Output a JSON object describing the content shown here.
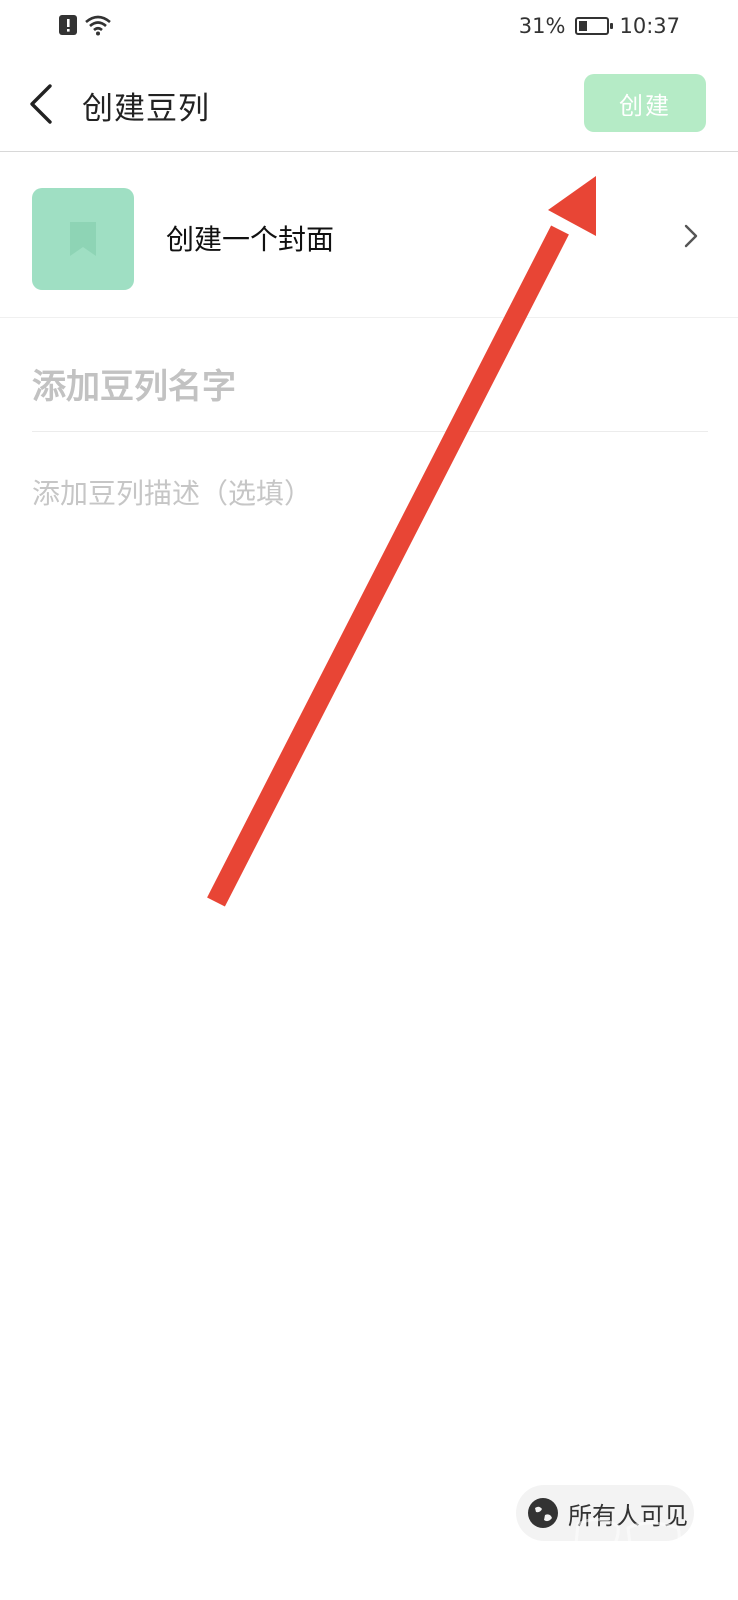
{
  "status_bar": {
    "battery": "31%",
    "time": "10:37",
    "battery_level": 0.31,
    "icons": [
      "alert-icon",
      "wifi-icon",
      "battery-icon"
    ]
  },
  "nav": {
    "title": "创建豆列",
    "create_label": "创建"
  },
  "cover": {
    "label": "创建一个封面",
    "icon": "bookmark-icon"
  },
  "form": {
    "name_placeholder": "添加豆列名字",
    "description_placeholder": "添加豆列描述（选填）"
  },
  "footer": {
    "visibility_label": "所有人可见",
    "icon": "globe-icon"
  },
  "colors": {
    "accent": "#b5ebc6",
    "cover": "#9fdfc3",
    "arrow": "#e84535"
  }
}
